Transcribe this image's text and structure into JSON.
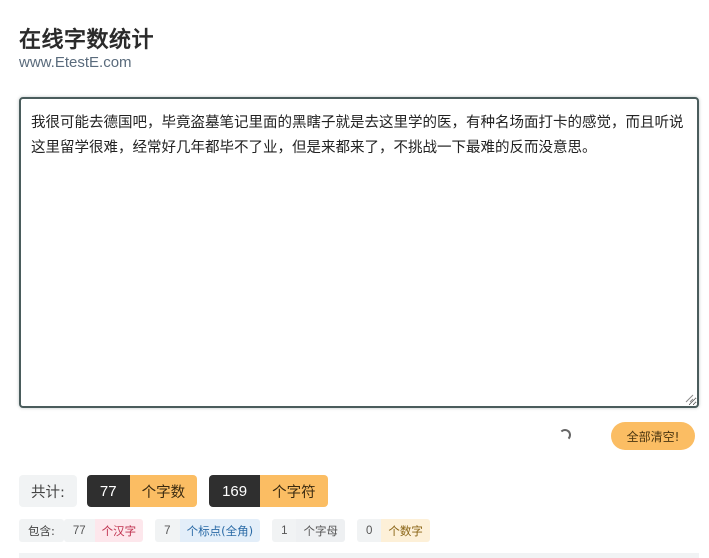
{
  "header": {
    "title": "在线字数统计",
    "site": "www.EtestE.com"
  },
  "editor": {
    "text": "我很可能去德国吧，毕竟盗墓笔记里面的黑瞎子就是去这里学的医，有种名场面打卡的感觉，而且听说这里留学很难，经常好几年都毕不了业，但是来都来了，不挑战一下最难的反而没意思。"
  },
  "actions": {
    "clear_label": "全部清空!"
  },
  "stats": {
    "total_label": "共计:",
    "char_count": "77",
    "char_count_label": "个字数",
    "symbol_count": "169",
    "symbol_count_label": "个字符"
  },
  "detail": {
    "contains_label": "包含:",
    "hanzi": "77",
    "hanzi_label": "个汉字",
    "punct": "7",
    "punct_label": "个标点(全角)",
    "letters": "1",
    "letters_label": "个字母",
    "digits": "0",
    "digits_label": "个数字"
  },
  "colors": {
    "accent": "#fbbd63",
    "dark": "#2f2f2f",
    "editor_border": "#4a5c5c"
  }
}
